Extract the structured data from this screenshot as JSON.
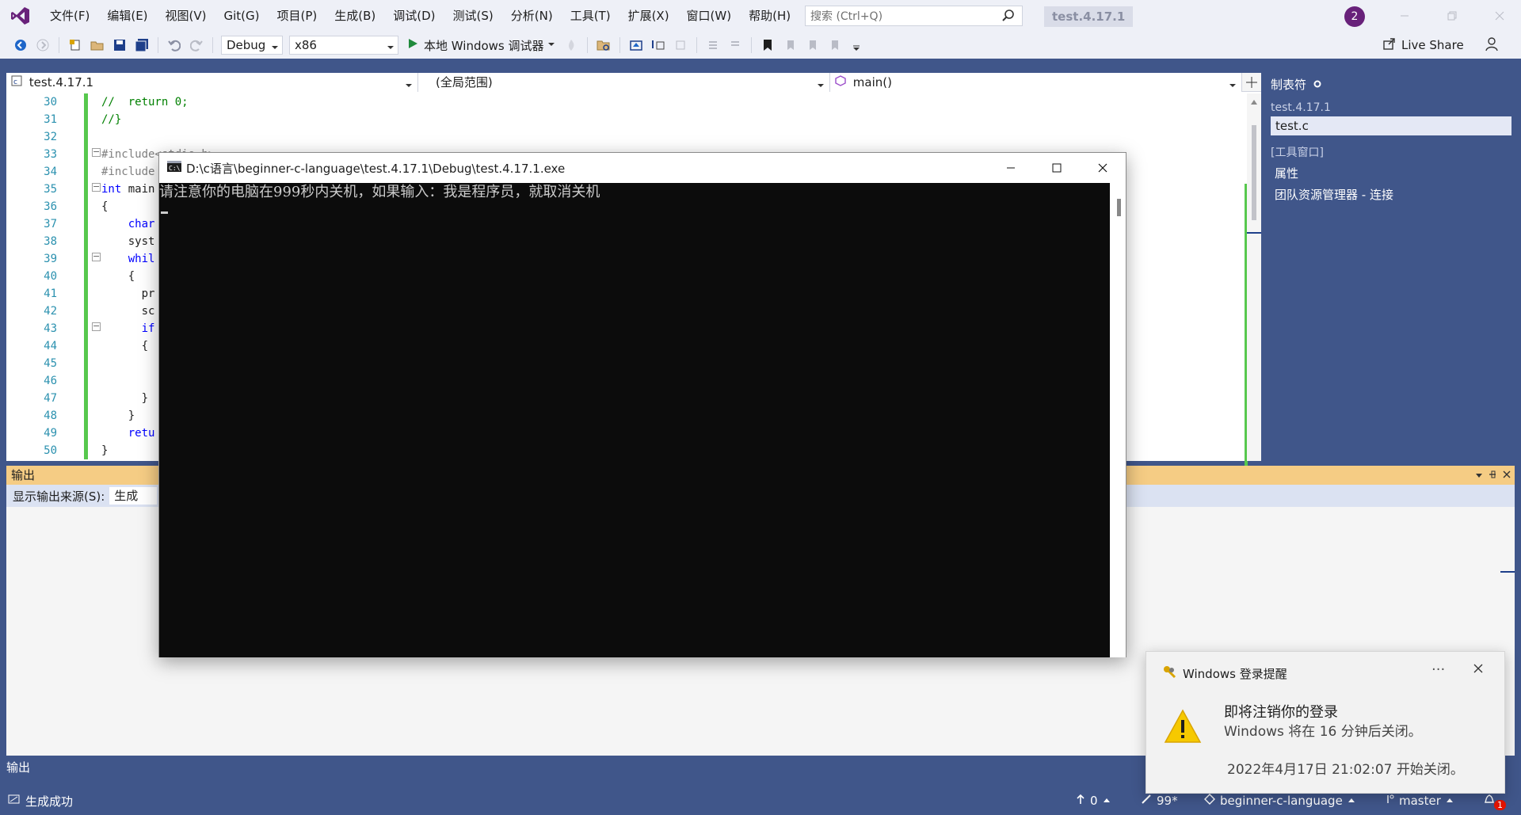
{
  "menu": {
    "items": [
      "文件(F)",
      "编辑(E)",
      "视图(V)",
      "Git(G)",
      "项目(P)",
      "生成(B)",
      "调试(D)",
      "测试(S)",
      "分析(N)",
      "工具(T)",
      "扩展(X)",
      "窗口(W)",
      "帮助(H)"
    ],
    "search_placeholder": "搜索 (Ctrl+Q)",
    "solution_name": "test.4.17.1",
    "notification_count": "2"
  },
  "toolbar": {
    "configuration": "Debug",
    "platform": "x86",
    "debugger_label": "本地 Windows 调试器",
    "live_share": "Live Share"
  },
  "editor": {
    "nav_project": "test.4.17.1",
    "nav_scope": "(全局范围)",
    "nav_member": "main()",
    "line_numbers": [
      "30",
      "31",
      "32",
      "33",
      "34",
      "35",
      "36",
      "37",
      "38",
      "39",
      "40",
      "41",
      "42",
      "43",
      "44",
      "45",
      "46",
      "47",
      "48",
      "49",
      "50"
    ],
    "lines": {
      "l30": "//  return 0;",
      "l31": "//}",
      "l33": "#include<stdio.h>",
      "l34": "#include",
      "l35_kw": "int",
      "l35": " main",
      "l36": "{",
      "l37": "    char",
      "l38": "    syst",
      "l39": "    whil",
      "l40": "    {",
      "l41": "      pr",
      "l42": "      sc",
      "l43": "      if",
      "l44": "      {",
      "l47": "      }",
      "l48": "    }",
      "l49": "    retu",
      "l50": "}"
    }
  },
  "solution_explorer": {
    "title": "制表符",
    "project": "test.4.17.1",
    "selected_file": "test.c",
    "group_label": "[工具窗口]",
    "items": [
      "属性",
      "团队资源管理器 - 连接"
    ]
  },
  "output": {
    "header": "输出",
    "source_label": "显示输出来源(S):",
    "source_value": "生成",
    "tab_label": "输出"
  },
  "status_bar": {
    "status_text": "生成成功",
    "push_count": "0",
    "changes": "99*",
    "repository": "beginner-c-language",
    "branch": "master",
    "notif_count": "1"
  },
  "console": {
    "title": "D:\\c语言\\beginner-c-language\\test.4.17.1\\Debug\\test.4.17.1.exe",
    "output_text": "请注意你的电脑在999秒内关机，如果输入：我是程序员，就取消关机"
  },
  "toast": {
    "app_name": "Windows 登录提醒",
    "more": "···",
    "title": "即将注销你的登录",
    "body": "Windows 将在 16 分钟后关闭。",
    "timestamp": "2022年4月17日 21:02:07 开始关闭。"
  },
  "colors": {
    "frame_blue": "#40568a",
    "output_header": "#f5cc84",
    "vs_purple": "#68217a",
    "change_bar_green": "#57c84d",
    "console_bg": "#0c0c0c"
  }
}
